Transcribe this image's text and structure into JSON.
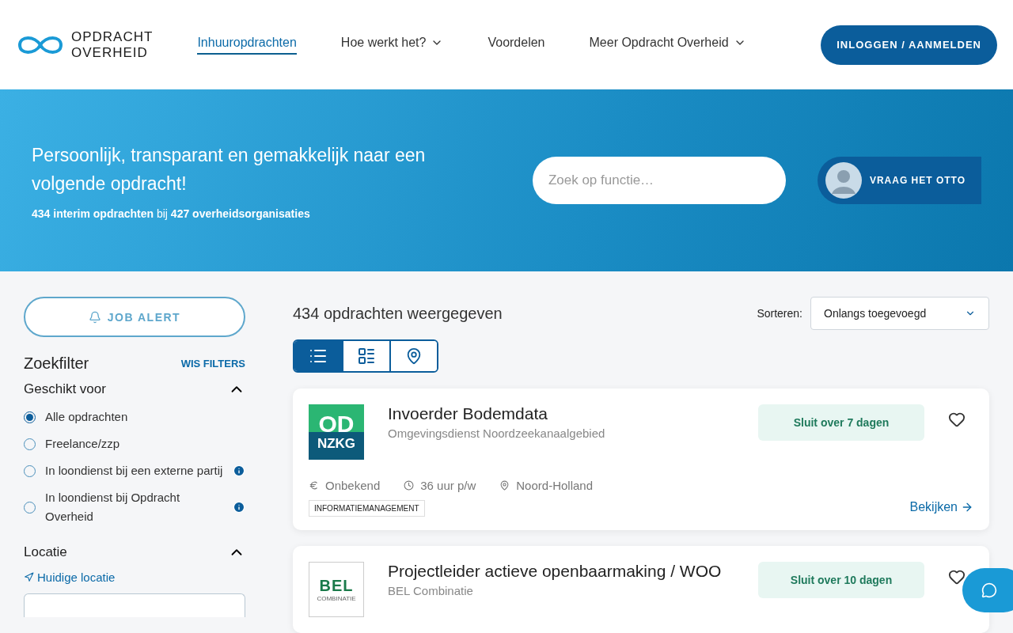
{
  "header": {
    "logo": {
      "line_1": "OPDRACHT",
      "line_2": "OVERHEID"
    },
    "nav": [
      {
        "label": "Inhuuropdrachten",
        "selected": true,
        "dropdown": false
      },
      {
        "label": "Hoe werkt het?",
        "selected": false,
        "dropdown": true
      },
      {
        "label": "Voordelen",
        "selected": false,
        "dropdown": false
      },
      {
        "label": "Meer Opdracht Overheid",
        "selected": false,
        "dropdown": true
      }
    ],
    "login_button": "INLOGGEN / AANMELDEN"
  },
  "hero": {
    "title": "Persoonlijk, transparant en gemakkelijk naar een volgende opdracht!",
    "subtitle": "**434 interim opdrachten** bij **427 overheidsorganisaties**",
    "search": {
      "placeholder": "Zoek op functie…"
    },
    "assistant_button": "VRAAG HET OTTO"
  },
  "sidebar": {
    "job_alert": "JOB ALERT",
    "filter_title": "Zoekfilter",
    "clear_filters": "WIS FILTERS",
    "sections": [
      {
        "title": "Geschikt voor",
        "expanded": true,
        "options": [
          {
            "label": "Alle opdrachten",
            "selected": true,
            "info": false
          },
          {
            "label": "Freelance/zzp",
            "selected": false,
            "info": false
          },
          {
            "label": "In loondienst bij een externe partij",
            "selected": false,
            "info": true
          },
          {
            "label": "In loondienst bij Opdracht Overheid",
            "selected": false,
            "info": true
          }
        ]
      },
      {
        "title": "Locatie",
        "expanded": true,
        "link": "Huidige locatie"
      }
    ]
  },
  "results": {
    "count": "434 opdrachten weergegeven",
    "sort": {
      "label": "Sorteren:",
      "value": "Onlangs toegevoegd"
    },
    "views": [
      {
        "kind": "list",
        "selected": true
      },
      {
        "kind": "grid",
        "selected": false
      },
      {
        "kind": "map",
        "selected": false
      }
    ],
    "jobs": [
      {
        "title": "Invoerder Bodemdata",
        "organization": "Omgevingsdienst Noordzeekanaalgebied",
        "logo": {
          "kind": "odnzkg",
          "line_1": "OD",
          "line_2": "NZKG"
        },
        "deadline": "Sluit over 7 dagen",
        "favorite": false,
        "salary": "Onbekend",
        "hours": "36 uur p/w",
        "region": "Noord-Holland",
        "tags": [
          "INFORMATIEMANAGEMENT"
        ],
        "link": "Bekijken"
      },
      {
        "title": "Projectleider actieve openbaarmaking / WOO",
        "organization": "BEL Combinatie",
        "logo": {
          "kind": "bel",
          "line_1": "BEL",
          "line_2": "COMBINATIE"
        },
        "deadline": "Sluit over 10 dagen",
        "favorite": false
      }
    ]
  }
}
